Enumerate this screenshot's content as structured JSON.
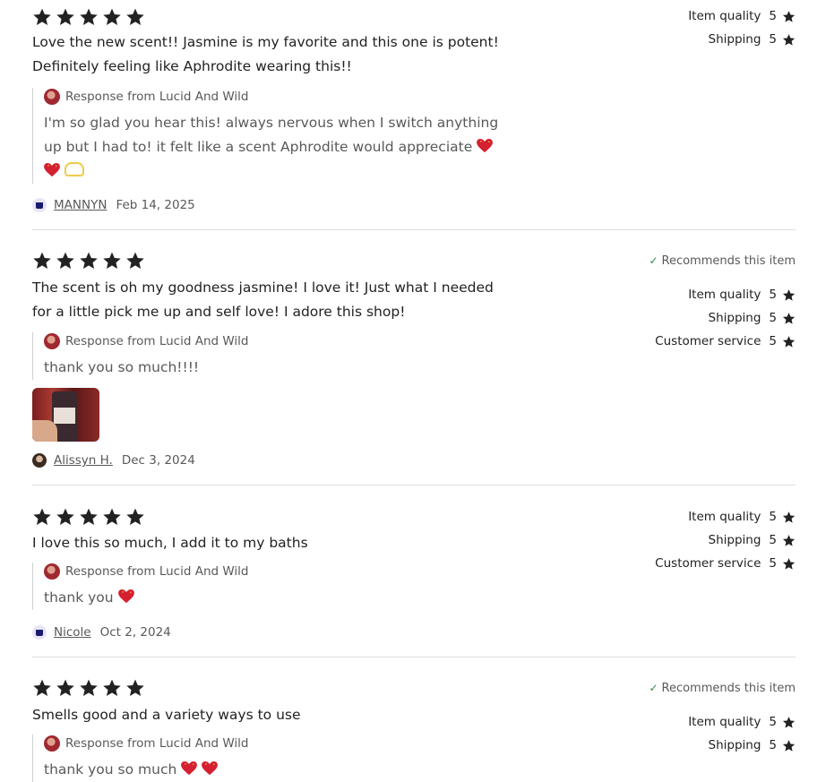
{
  "colors": {
    "star": "#222222",
    "check": "#2d8a4a",
    "heart": "#d42030",
    "hands": "#f2c94c"
  },
  "icons": {
    "star": "star-icon",
    "check": "check-icon",
    "heart": "sparkling-heart-icon",
    "hands": "heart-hands-icon"
  },
  "reviews": [
    {
      "rating": 5,
      "text": "Love the new scent!! Jasmine is my favorite and this one is potent! Definitely feeling like Aphrodite wearing this!!",
      "response_label": "Response from Lucid And Wild",
      "response_text": "I'm so glad you hear this! always nervous when I switch anything up but I had to! it felt like a scent Aphrodite would appreciate",
      "recommends": "",
      "ratings": [
        {
          "label": "Item quality",
          "value": "5"
        },
        {
          "label": "Shipping",
          "value": "5"
        }
      ],
      "user": "MANNYN",
      "date": "Feb 14, 2025"
    },
    {
      "rating": 5,
      "text": "The scent is oh my goodness jasmine! I love it! Just what I needed for a little pick me up and self love! I adore this shop!",
      "response_label": "Response from Lucid And Wild",
      "response_text": "thank you so much!!!!",
      "recommends": "Recommends this item",
      "ratings": [
        {
          "label": "Item quality",
          "value": "5"
        },
        {
          "label": "Shipping",
          "value": "5"
        },
        {
          "label": "Customer service",
          "value": "5"
        }
      ],
      "user": "Alissyn H.",
      "date": "Dec 3, 2024"
    },
    {
      "rating": 5,
      "text": "I love this so much, I add it to my baths",
      "response_label": "Response from Lucid And Wild",
      "response_text": "thank you",
      "recommends": "",
      "ratings": [
        {
          "label": "Item quality",
          "value": "5"
        },
        {
          "label": "Shipping",
          "value": "5"
        },
        {
          "label": "Customer service",
          "value": "5"
        }
      ],
      "user": "Nicole",
      "date": "Oct 2, 2024"
    },
    {
      "rating": 5,
      "text": "Smells good and a variety ways to use",
      "response_label": "Response from Lucid And Wild",
      "response_text": "thank you so much",
      "recommends": "Recommends this item",
      "ratings": [
        {
          "label": "Item quality",
          "value": "5"
        },
        {
          "label": "Shipping",
          "value": "5"
        }
      ],
      "user": "",
      "date": ""
    }
  ]
}
